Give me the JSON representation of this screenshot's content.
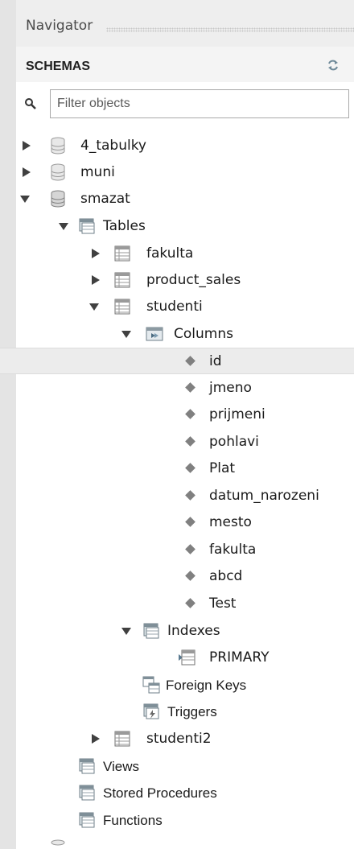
{
  "navigator": {
    "title": "Navigator",
    "schemas_label": "SCHEMAS",
    "filter_placeholder": "Filter objects"
  },
  "colors": {
    "header_bg": "#eeeeee",
    "selected_row_bg": "#ececec",
    "tree_arrow": "#404040",
    "db_icon": "#9a9a9a"
  },
  "tree": {
    "schemas": [
      {
        "label": "4_tabulky",
        "state": "collapsed",
        "icon": "database-icon"
      },
      {
        "label": "muni",
        "state": "collapsed",
        "icon": "database-icon"
      },
      {
        "label": "smazat",
        "state": "expanded",
        "icon": "database-icon"
      }
    ],
    "tables_group": {
      "label": "Tables",
      "state": "expanded",
      "icon": "tables-folder-icon"
    },
    "tables": [
      {
        "label": "fakulta",
        "state": "collapsed",
        "icon": "table-icon"
      },
      {
        "label": "product_sales",
        "state": "collapsed",
        "icon": "table-icon"
      },
      {
        "label": "studenti",
        "state": "expanded",
        "icon": "table-icon"
      }
    ],
    "columns_group": {
      "label": "Columns",
      "state": "expanded",
      "icon": "columns-folder-icon"
    },
    "columns": [
      {
        "label": "id",
        "selected": true
      },
      {
        "label": "jmeno"
      },
      {
        "label": "prijmeni"
      },
      {
        "label": "pohlavi"
      },
      {
        "label": "Plat"
      },
      {
        "label": "datum_narozeni"
      },
      {
        "label": "mesto"
      },
      {
        "label": "fakulta"
      },
      {
        "label": "abcd"
      },
      {
        "label": "Test"
      }
    ],
    "indexes_group": {
      "label": "Indexes",
      "state": "expanded",
      "icon": "indexes-folder-icon"
    },
    "indexes": [
      {
        "label": "PRIMARY",
        "icon": "index-icon"
      }
    ],
    "foreign_keys": {
      "label": "Foreign Keys",
      "icon": "foreign-keys-icon"
    },
    "triggers": {
      "label": "Triggers",
      "icon": "triggers-icon"
    },
    "table_after": {
      "label": "studenti2",
      "state": "collapsed",
      "icon": "table-icon"
    },
    "views": {
      "label": "Views",
      "icon": "views-folder-icon"
    },
    "stored_procedures": {
      "label": "Stored Procedures",
      "icon": "procedures-folder-icon"
    },
    "functions": {
      "label": "Functions",
      "icon": "functions-folder-icon"
    }
  }
}
